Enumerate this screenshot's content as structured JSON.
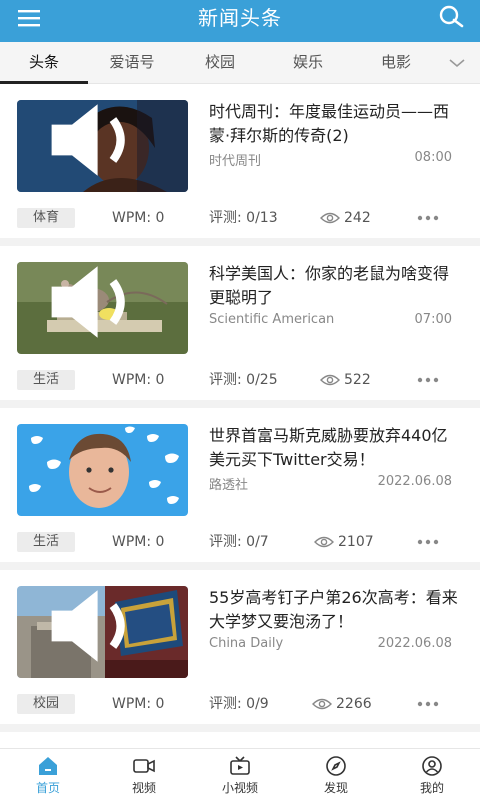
{
  "header": {
    "title": "新闻头条",
    "menu_icon": "menu-icon",
    "search_icon": "search-icon",
    "color": "#3aa0d8"
  },
  "tabs": [
    {
      "label": "头条",
      "active": true
    },
    {
      "label": "爱语号"
    },
    {
      "label": "校园"
    },
    {
      "label": "娱乐"
    },
    {
      "label": "电影"
    }
  ],
  "tab_more_icon": "chevron-down-icon",
  "articles": [
    {
      "title": "时代周刊：年度最佳运动员——西蒙·拜尔斯的传奇(2)",
      "source": "时代周刊",
      "time": "08:00",
      "tag": "体育",
      "wpm": "WPM: 0",
      "review": "评测: 0/13",
      "views": "242",
      "thumb": "athlete-photo"
    },
    {
      "title": "科学美国人：你家的老鼠为啥变得更聪明了",
      "source": "Scientific American",
      "time": "07:00",
      "tag": "生活",
      "wpm": "WPM: 0",
      "review": "评测: 0/25",
      "views": "522",
      "thumb": "mouse-trap-photo"
    },
    {
      "title": "世界首富马斯克威胁要放弃440亿美元买下Twitter交易！",
      "source": "路透社",
      "time": "2022.06.08",
      "tag": "生活",
      "wpm": "WPM: 0",
      "review": "评测: 0/7",
      "views": "2107",
      "thumb": "twitter-birds-photo"
    },
    {
      "title": "55岁高考钉子户第26次高考：看来大学梦又要泡汤了！",
      "source": "China Daily",
      "time": "2022.06.08",
      "tag": "校园",
      "wpm": "WPM: 0",
      "review": "评测: 0/9",
      "views": "2266",
      "thumb": "university-gate-photo"
    }
  ],
  "bottom_nav": [
    {
      "label": "首页",
      "icon": "home-icon",
      "active": true
    },
    {
      "label": "视频",
      "icon": "video-camera-icon"
    },
    {
      "label": "小视频",
      "icon": "tv-icon"
    },
    {
      "label": "发现",
      "icon": "compass-icon"
    },
    {
      "label": "我的",
      "icon": "user-icon"
    }
  ]
}
